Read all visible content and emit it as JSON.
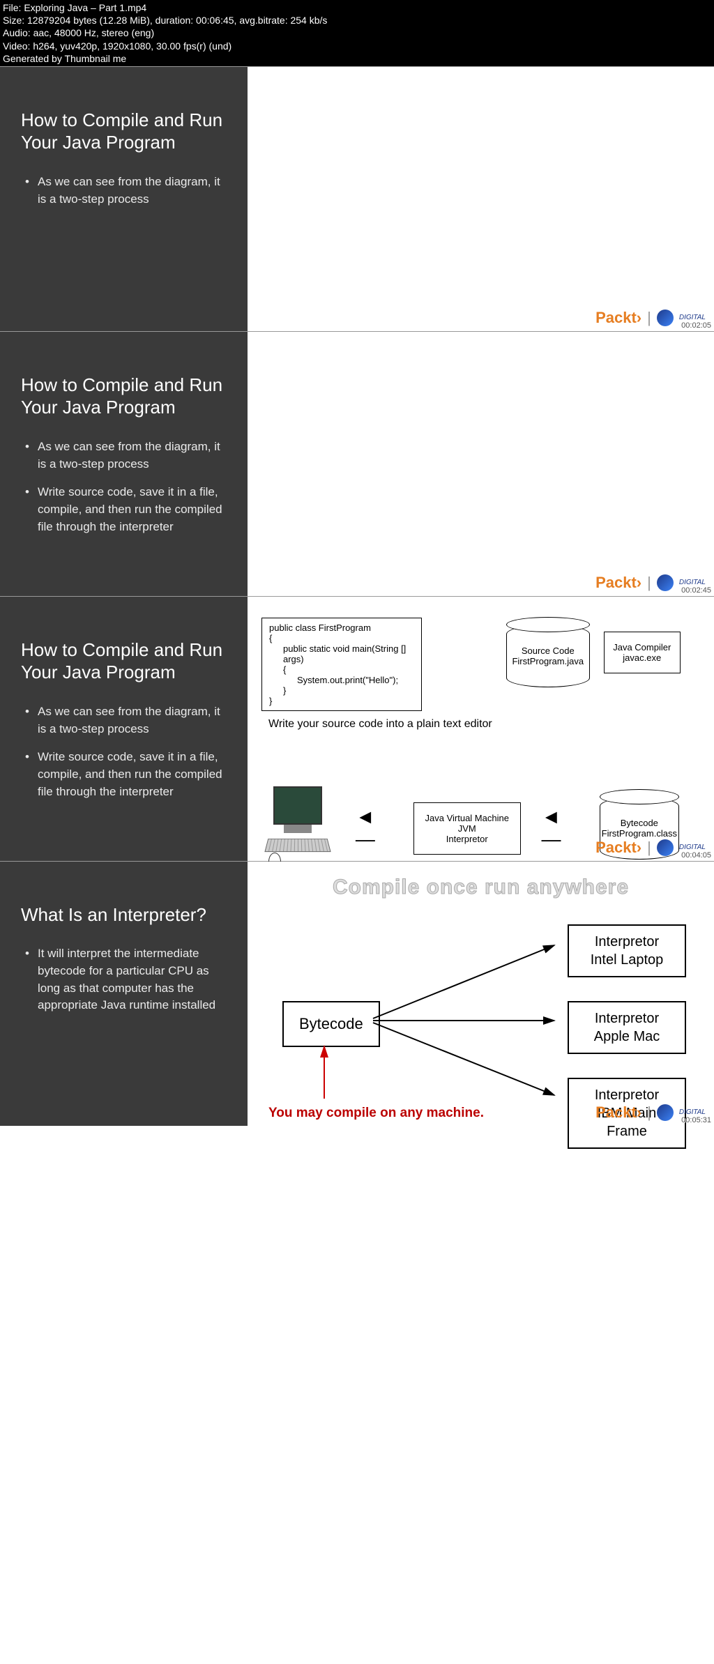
{
  "header": {
    "file": "File: Exploring Java – Part 1.mp4",
    "size": "Size: 12879204 bytes (12.28 MiB), duration: 00:06:45, avg.bitrate: 254 kb/s",
    "audio": "Audio: aac, 48000 Hz, stereo (eng)",
    "video": "Video: h264, yuv420p, 1920x1080, 30.00 fps(r) (und)",
    "gen": "Generated by Thumbnail me"
  },
  "packt": {
    "label": "Packt›",
    "digital": "DIGITAL"
  },
  "slides": [
    {
      "title": "How to Compile and Run Your Java Program",
      "bullets": [
        "As we can see from the diagram, it is a two-step process"
      ],
      "timestamp": "00:02:05"
    },
    {
      "title": "How to Compile and Run Your Java Program",
      "bullets": [
        "As we can see from the diagram, it is a two-step process",
        "Write source code, save it in a file, compile, and then run the compiled file through the interpreter"
      ],
      "timestamp": "00:02:45"
    },
    {
      "title": "How to Compile and Run Your Java Program",
      "bullets": [
        "As we can see from the diagram, it is a two-step process",
        "Write source code, save it in a file, compile, and then run the compiled file through the interpreter"
      ],
      "timestamp": "00:04:05"
    },
    {
      "title": "What Is an Interpreter?",
      "bullets": [
        "It will interpret the intermediate bytecode for a particular CPU as long as that computer has the appropriate Java runtime installed"
      ],
      "timestamp": "00:05:31"
    }
  ],
  "diagram3": {
    "code": {
      "l1": "public class FirstProgram",
      "l2": "{",
      "l3": "public static void main(String [] args)",
      "l4": "{",
      "l5": "System.out.print(\"Hello\");",
      "l6": "}",
      "l7": "}"
    },
    "caption": "Write your source code into a plain text editor",
    "source_cyl": {
      "l1": "Source Code",
      "l2": "FirstProgram.java"
    },
    "compiler": {
      "l1": "Java Compiler",
      "l2": "javac.exe"
    },
    "jvm": {
      "l1": "Java Virtual Machine",
      "l2": "JVM",
      "l3": "Interpretor"
    },
    "byte_cyl": {
      "l1": "Bytecode",
      "l2": "FirstProgram.class"
    }
  },
  "diagram4": {
    "title": "Compile once run anywhere",
    "bytecode": "Bytecode",
    "i1": {
      "l1": "Interpretor",
      "l2": "Intel Laptop"
    },
    "i2": {
      "l1": "Interpretor",
      "l2": "Apple Mac"
    },
    "i3": {
      "l1": "Interpretor",
      "l2": "IBM Main Frame"
    },
    "note": "You may compile on any machine."
  }
}
